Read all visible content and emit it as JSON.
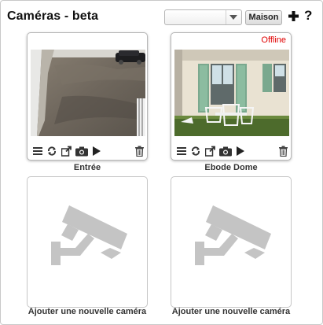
{
  "header": {
    "title": "Caméras - beta",
    "location_select_value": "",
    "location_button": "Maison",
    "add_icon": "plus-icon",
    "help_label": "?"
  },
  "cameras": [
    {
      "name": "Entrée",
      "status": "",
      "feed": "gravel-driveway-with-parked-car"
    },
    {
      "name": "Ebode Dome",
      "status": "Offline",
      "feed": "house-facade-with-green-shutters-and-garden-chairs"
    }
  ],
  "toolbar_icons": [
    "list-icon",
    "refresh-icon",
    "popout-icon",
    "snapshot-icon",
    "play-icon",
    "trash-icon"
  ],
  "empty_slots": [
    {
      "label": "Ajouter une nouvelle caméra",
      "icon": "camera-placeholder-icon"
    },
    {
      "label": "Ajouter une nouvelle caméra",
      "icon": "camera-placeholder-icon"
    }
  ],
  "colors": {
    "offline": "#e00000",
    "placeholder_icon": "#c4c4c4",
    "shutter_green": "#7aa88e"
  }
}
